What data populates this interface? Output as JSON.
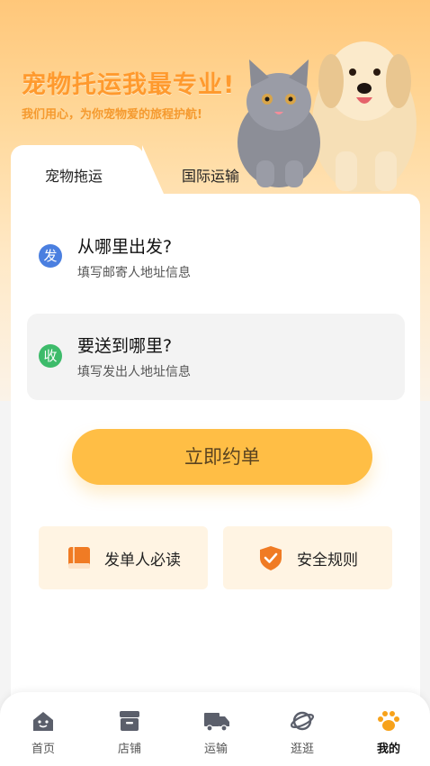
{
  "hero": {
    "title": "宠物托运我最专业!",
    "subtitle": "我们用心，为你宠物爱的旅程护航!"
  },
  "tabs": [
    {
      "label": "宠物拖运",
      "active": true
    },
    {
      "label": "国际运输",
      "active": false
    }
  ],
  "origin": {
    "badge": "发",
    "title": "从哪里出发?",
    "hint": "填写邮寄人地址信息",
    "badge_color": "#4a7fe0"
  },
  "destination": {
    "badge": "收",
    "title": "要送到哪里?",
    "hint": "填写发出人地址信息",
    "badge_color": "#3dbb6a"
  },
  "order_button": "立即约单",
  "info_cards": [
    {
      "label": "发单人必读",
      "icon": "book-icon"
    },
    {
      "label": "安全规则",
      "icon": "shield-check-icon"
    }
  ],
  "tabbar": [
    {
      "label": "首页",
      "icon": "home-icon"
    },
    {
      "label": "店铺",
      "icon": "store-icon"
    },
    {
      "label": "运输",
      "icon": "truck-icon"
    },
    {
      "label": "逛逛",
      "icon": "planet-icon"
    },
    {
      "label": "我的",
      "icon": "paw-icon",
      "active": true
    }
  ],
  "colors": {
    "accent": "#ffbe45",
    "brand_orange": "#ff9a2e",
    "icon_orange": "#f07b24"
  }
}
